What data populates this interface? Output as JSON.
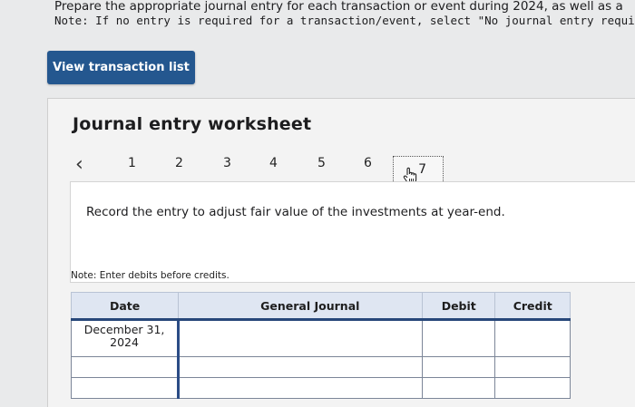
{
  "instructions": {
    "line1": "Prepare the appropriate journal entry for each transaction or event during 2024, as well as a",
    "line2": "Note: If no entry is required for a transaction/event, select \"No journal entry required\" in the"
  },
  "view_button_label": "View transaction list",
  "worksheet": {
    "title": "Journal entry worksheet",
    "pager": {
      "prev_icon": "chevron-left-icon",
      "pages": [
        "1",
        "2",
        "3",
        "4",
        "5",
        "6"
      ],
      "current": "7"
    },
    "record_text": "Record the entry to adjust fair value of the investments at year-end.",
    "note": "Note: Enter debits before credits.",
    "table": {
      "headers": {
        "date": "Date",
        "general_journal": "General Journal",
        "debit": "Debit",
        "credit": "Credit"
      },
      "rows": [
        {
          "date": "December 31, 2024",
          "account": "",
          "debit": "",
          "credit": ""
        },
        {
          "date": "",
          "account": "",
          "debit": "",
          "credit": ""
        },
        {
          "date": "",
          "account": "",
          "debit": "",
          "credit": ""
        }
      ]
    }
  }
}
